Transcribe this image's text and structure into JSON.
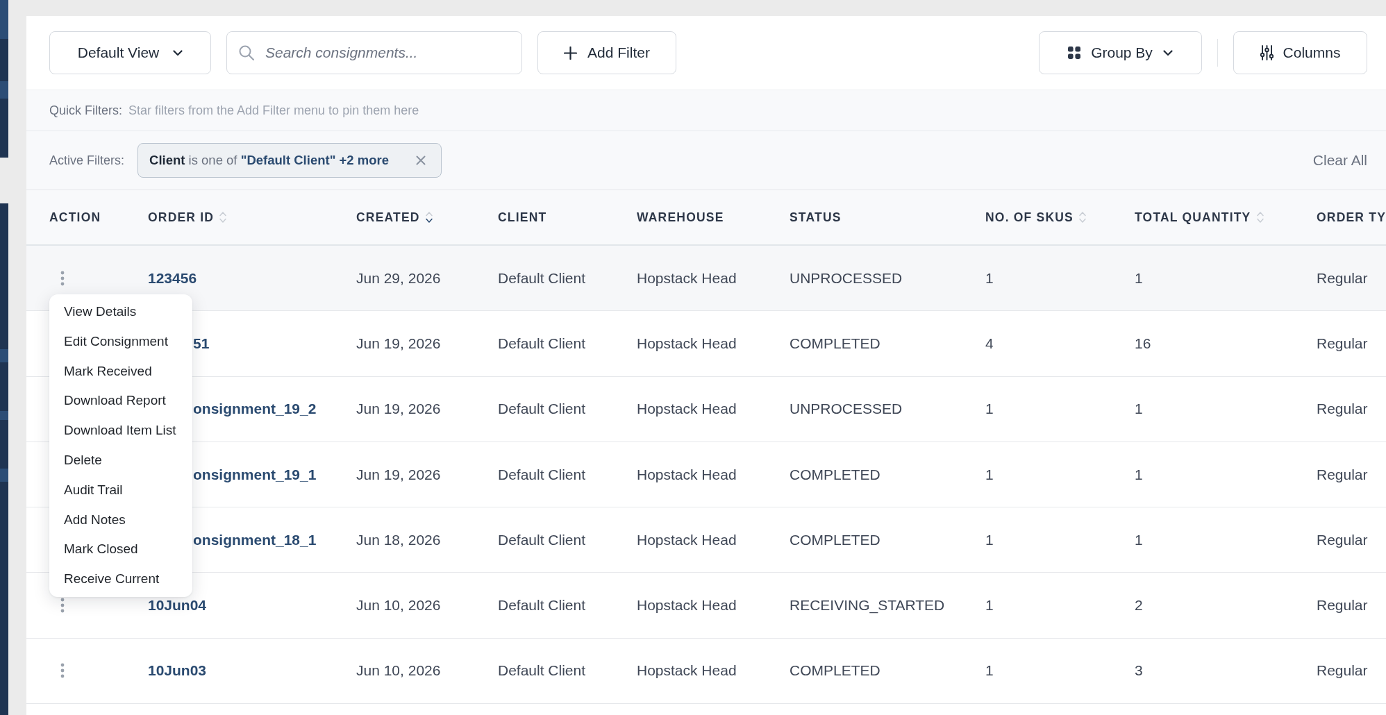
{
  "toolbar": {
    "view_selector": {
      "label": "Default View"
    },
    "search": {
      "placeholder": "Search consignments..."
    },
    "add_filter": {
      "label": "Add Filter"
    },
    "group_by": {
      "label": "Group By"
    },
    "columns_button": {
      "label": "Columns"
    }
  },
  "quick_filters": {
    "label": "Quick Filters:",
    "hint": "Star filters from the Add Filter menu to pin them here"
  },
  "active_filters": {
    "label": "Active Filters:",
    "chips": [
      {
        "field": "Client",
        "operator": "is one of",
        "value": "\"Default Client\" +2 more"
      }
    ],
    "clear_all": "Clear All"
  },
  "table": {
    "columns": [
      {
        "label": "ACTION",
        "kind": "action",
        "sortable": false
      },
      {
        "label": "ORDER ID",
        "kind": "link",
        "sortable": true,
        "sorted": false
      },
      {
        "label": "CREATED",
        "kind": "text",
        "sortable": true,
        "sorted": true
      },
      {
        "label": "CLIENT",
        "kind": "text",
        "sortable": false
      },
      {
        "label": "WAREHOUSE",
        "kind": "text",
        "sortable": false
      },
      {
        "label": "STATUS",
        "kind": "text",
        "sortable": false
      },
      {
        "label": "NO. OF SKUS",
        "kind": "text",
        "sortable": true,
        "sorted": false
      },
      {
        "label": "TOTAL QUANTITY",
        "kind": "text",
        "sortable": true,
        "sorted": false
      },
      {
        "label": "ORDER TY",
        "kind": "text",
        "sortable": false
      }
    ],
    "rows": [
      {
        "menu_open": true,
        "cells": [
          "",
          "123456",
          "Jun 29, 2026",
          "Default Client",
          "Hopstack Head",
          "UNPROCESSED",
          "1",
          "1",
          "Regular"
        ]
      },
      {
        "menu_open": false,
        "cells": [
          "",
          "51",
          "Jun 19, 2026",
          "Default Client",
          "Hopstack Head",
          "COMPLETED",
          "4",
          "16",
          "Regular"
        ]
      },
      {
        "menu_open": false,
        "cells": [
          "",
          "onsignment_19_2",
          "Jun 19, 2026",
          "Default Client",
          "Hopstack Head",
          "UNPROCESSED",
          "1",
          "1",
          "Regular"
        ]
      },
      {
        "menu_open": false,
        "cells": [
          "",
          "onsignment_19_1",
          "Jun 19, 2026",
          "Default Client",
          "Hopstack Head",
          "COMPLETED",
          "1",
          "1",
          "Regular"
        ]
      },
      {
        "menu_open": false,
        "cells": [
          "",
          "onsignment_18_1",
          "Jun 18, 2026",
          "Default Client",
          "Hopstack Head",
          "COMPLETED",
          "1",
          "1",
          "Regular"
        ]
      },
      {
        "menu_open": false,
        "cells": [
          "",
          "10Jun04",
          "Jun 10, 2026",
          "Default Client",
          "Hopstack Head",
          "RECEIVING_STARTED",
          "1",
          "2",
          "Regular"
        ]
      },
      {
        "menu_open": false,
        "cells": [
          "",
          "10Jun03",
          "Jun 10, 2026",
          "Default Client",
          "Hopstack Head",
          "COMPLETED",
          "1",
          "3",
          "Regular"
        ]
      }
    ],
    "row_menu": {
      "items": [
        "View Details",
        "Edit Consignment",
        "Mark Received",
        "Download Report",
        "Download Item List",
        "Delete",
        "Audit Trail",
        "Add Notes",
        "Mark Closed",
        "Receive Current"
      ]
    }
  }
}
